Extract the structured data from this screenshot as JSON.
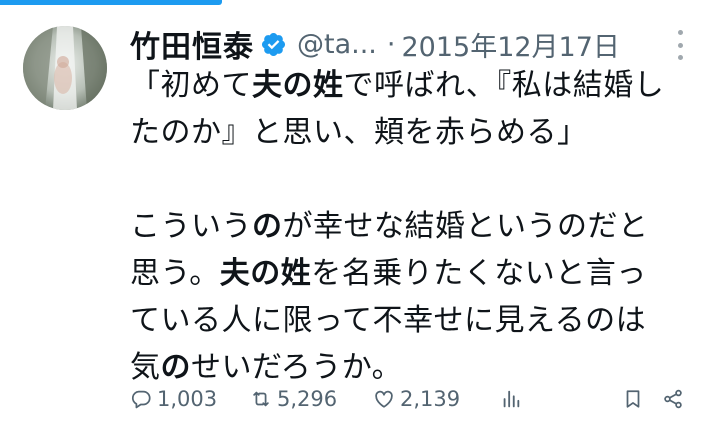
{
  "tweet": {
    "author_name": "竹田恒泰",
    "handle": "@ta...",
    "separator": "·",
    "date": "2015年12月17日",
    "icons": {
      "verified": "verified-badge-icon",
      "more": "more-vertical-icon",
      "avatar": "avatar-image"
    },
    "colors": {
      "accent": "#1d9bf0",
      "secondary_text": "#536471",
      "text": "#0f1419"
    },
    "body": {
      "p1_s1": "「初めて",
      "p1_b1": "夫の姓",
      "p1_s2": "で呼ばれ、『私は結婚し",
      "p1_s3": "たのか』と思い、頬を赤らめる」",
      "p2_s1": "こういう",
      "p2_b1": "の",
      "p2_s2": "が幸せな結婚というのだと",
      "p2_s3": "思う。",
      "p2_b2": "夫の姓",
      "p2_s4": "を名乗りたくないと言っ",
      "p2_s5": "ている人に限って不幸せに見えるのは",
      "p2_s6": "気",
      "p2_b3": "の",
      "p2_s7": "せいだろうか。"
    }
  },
  "actions": {
    "reply": {
      "icon": "reply-icon",
      "count": "1,003"
    },
    "repost": {
      "icon": "repost-icon",
      "count": "5,296"
    },
    "like": {
      "icon": "like-icon",
      "count": "2,139"
    },
    "views": {
      "icon": "views-icon"
    },
    "bookmark": {
      "icon": "bookmark-icon"
    },
    "share": {
      "icon": "share-icon"
    }
  }
}
